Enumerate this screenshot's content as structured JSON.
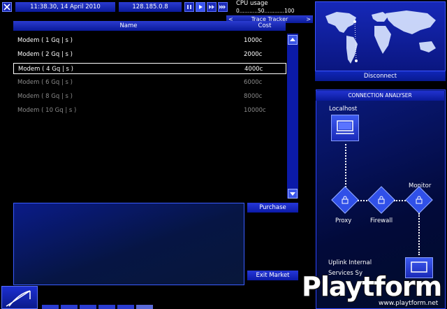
{
  "top_bar": {
    "datetime": "11:38.30, 14 April 2010",
    "ip": "128.185.0.8",
    "cpu_label": "CPU usage",
    "cpu_scale": "0...........50............100",
    "trace_label": "Trace Tracker"
  },
  "market": {
    "columns": {
      "name": "Name",
      "cost": "Cost"
    },
    "rows": [
      {
        "name": "Modem ( 1 Gq | s )",
        "cost": "1000c",
        "state": "available"
      },
      {
        "name": "Modem ( 2 Gq | s )",
        "cost": "2000c",
        "state": "available"
      },
      {
        "name": "Modem ( 4 Gq | s )",
        "cost": "4000c",
        "state": "selected"
      },
      {
        "name": "Modem ( 6 Gq | s )",
        "cost": "6000c",
        "state": "disabled"
      },
      {
        "name": "Modem ( 8 Gq | s )",
        "cost": "8000c",
        "state": "disabled"
      },
      {
        "name": "Modem ( 10 Gq | s )",
        "cost": "10000c",
        "state": "disabled"
      }
    ],
    "purchase_label": "Purchase",
    "exit_label": "Exit Market"
  },
  "map": {
    "disconnect_label": "Disconnect"
  },
  "analyser": {
    "title": "CONNECTION ANALYSER",
    "localhost": "Localhost",
    "proxy": "Proxy",
    "firewall": "Firewall",
    "monitor": "Monitor",
    "uplink": "Uplink Internal",
    "services": "Services Sy"
  },
  "watermark": {
    "brand": "Playtform",
    "url": "www.playtform.net"
  },
  "colors": {
    "accent": "#0b1aa8",
    "panel_border": "#3a5cff"
  }
}
